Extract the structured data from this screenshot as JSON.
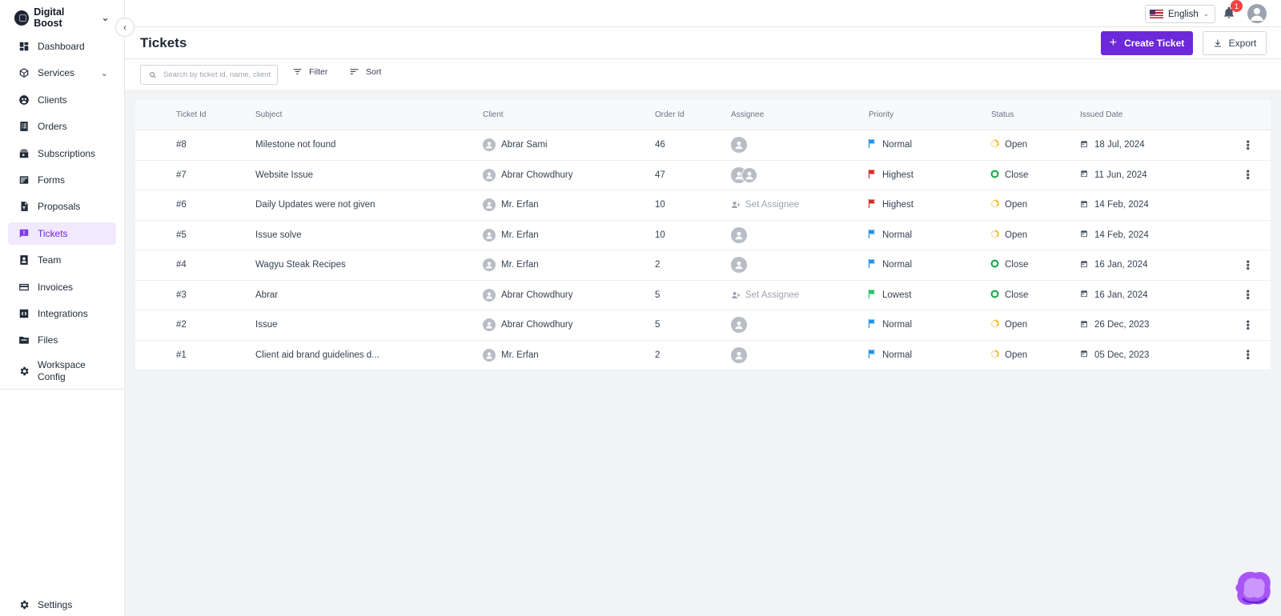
{
  "app": {
    "workspace": "Digital Boost"
  },
  "sidebar": {
    "items": [
      {
        "label": "Dashboard",
        "icon": "dashboard-icon"
      },
      {
        "label": "Services",
        "icon": "cube-icon",
        "expandable": true
      },
      {
        "label": "Clients",
        "icon": "clients-icon"
      },
      {
        "label": "Orders",
        "icon": "orders-icon"
      },
      {
        "label": "Subscriptions",
        "icon": "subscriptions-icon"
      },
      {
        "label": "Forms",
        "icon": "forms-icon"
      },
      {
        "label": "Proposals",
        "icon": "proposals-icon"
      },
      {
        "label": "Tickets",
        "icon": "tickets-icon",
        "active": true
      },
      {
        "label": "Team",
        "icon": "team-icon"
      },
      {
        "label": "Invoices",
        "icon": "invoices-icon"
      },
      {
        "label": "Integrations",
        "icon": "integrations-icon"
      },
      {
        "label": "Files",
        "icon": "files-icon"
      },
      {
        "label": "Workspace Config",
        "icon": "workspace-config-icon"
      }
    ],
    "settings_label": "Settings"
  },
  "topbar": {
    "language": "English",
    "notification_count": "1"
  },
  "header": {
    "title": "Tickets",
    "create_label": "Create Ticket",
    "export_label": "Export"
  },
  "toolbar": {
    "search_placeholder": "Search by ticket id, name, client",
    "filter_label": "Filter",
    "sort_label": "Sort"
  },
  "table": {
    "columns": [
      "Ticket Id",
      "Subject",
      "Client",
      "Order Id",
      "Assignee",
      "Priority",
      "Status",
      "Issued Date"
    ],
    "set_assignee_label": "Set Assignee",
    "rows": [
      {
        "id": "#8",
        "subject": "Milestone not found",
        "client": "Abrar Sami",
        "order": "46",
        "assignee": "single",
        "priority": "Normal",
        "status": "Open",
        "date": "18 Jul, 2024",
        "menu": true
      },
      {
        "id": "#7",
        "subject": "Website Issue",
        "client": "Abrar Chowdhury",
        "order": "47",
        "assignee": "double",
        "priority": "Highest",
        "status": "Close",
        "date": "11 Jun, 2024",
        "menu": true
      },
      {
        "id": "#6",
        "subject": "Daily Updates were not given",
        "client": "Mr. Erfan",
        "order": "10",
        "assignee": "none",
        "priority": "Highest",
        "status": "Open",
        "date": "14 Feb, 2024",
        "menu": false
      },
      {
        "id": "#5",
        "subject": "Issue solve",
        "client": "Mr. Erfan",
        "order": "10",
        "assignee": "single",
        "priority": "Normal",
        "status": "Open",
        "date": "14 Feb, 2024",
        "menu": false
      },
      {
        "id": "#4",
        "subject": "Wagyu Steak Recipes",
        "client": "Mr. Erfan",
        "order": "2",
        "assignee": "single",
        "priority": "Normal",
        "status": "Close",
        "date": "16 Jan, 2024",
        "menu": true
      },
      {
        "id": "#3",
        "subject": "Abrar",
        "client": "Abrar Chowdhury",
        "order": "5",
        "assignee": "none",
        "priority": "Lowest",
        "status": "Close",
        "date": "16 Jan, 2024",
        "menu": true
      },
      {
        "id": "#2",
        "subject": "Issue",
        "client": "Abrar Chowdhury",
        "order": "5",
        "assignee": "single",
        "priority": "Normal",
        "status": "Open",
        "date": "26 Dec, 2023",
        "menu": true
      },
      {
        "id": "#1",
        "subject": "Client aid brand guidelines d...",
        "client": "Mr. Erfan",
        "order": "2",
        "assignee": "single",
        "priority": "Normal",
        "status": "Open",
        "date": "05 Dec, 2023",
        "menu": true
      }
    ]
  },
  "colors": {
    "accent": "#6d28d9",
    "active_bg": "#f1e9fd",
    "priority_normal": "#1e90e6",
    "priority_highest": "#dc2626",
    "priority_lowest": "#22c55e",
    "status_open": "#f5b400",
    "status_close": "#16a34a"
  }
}
